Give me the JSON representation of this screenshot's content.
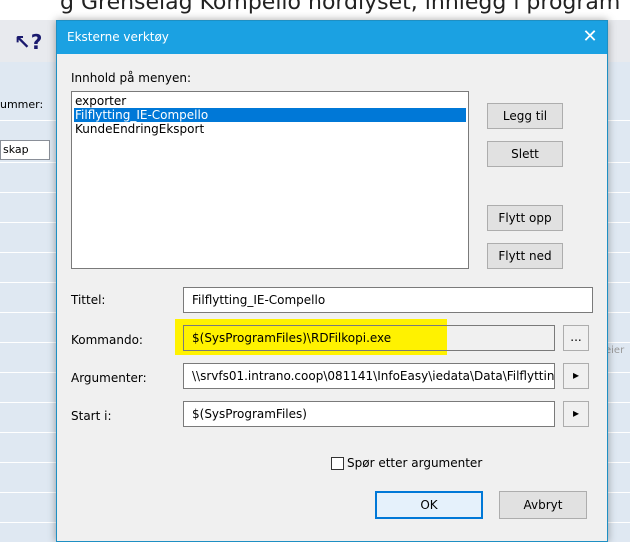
{
  "background": {
    "top_text": "g Grenselag Kompello nordlyset, innlegg i program",
    "left_labels": [
      "ummer:",
      "skap"
    ],
    "right_label": "eier",
    "help_icon": "help-cursor-icon"
  },
  "dialog": {
    "title": "Eksterne verktøy",
    "close_glyph": "✕",
    "list_label": "Innhold på menyen:",
    "items": [
      "exporter",
      "Filflytting_IE-Compello",
      "KundeEndringEksport"
    ],
    "selected_index": 1,
    "buttons": {
      "add": "Legg til",
      "delete": "Slett",
      "move_up": "Flytt opp",
      "move_down": "Flytt ned"
    },
    "fields": {
      "title_label": "Tittel:",
      "title_value": "Filflytting_IE-Compello",
      "command_label": "Kommando:",
      "command_value": "$(SysProgramFiles)\\RDFilkopi.exe",
      "arguments_label": "Argumenter:",
      "arguments_value": "\\\\srvfs01.intrano.coop\\081141\\InfoEasy\\iedata\\Data\\Filflyttin",
      "start_label": "Start i:",
      "start_value": "$(SysProgramFiles)"
    },
    "browse_glyph": "...",
    "arrow_glyph": "▸",
    "checkbox_label": "Spør etter argumenter",
    "ok": "OK",
    "cancel": "Avbryt",
    "highlight_color": "#fff200",
    "accent_color": "#1ba1e2"
  }
}
